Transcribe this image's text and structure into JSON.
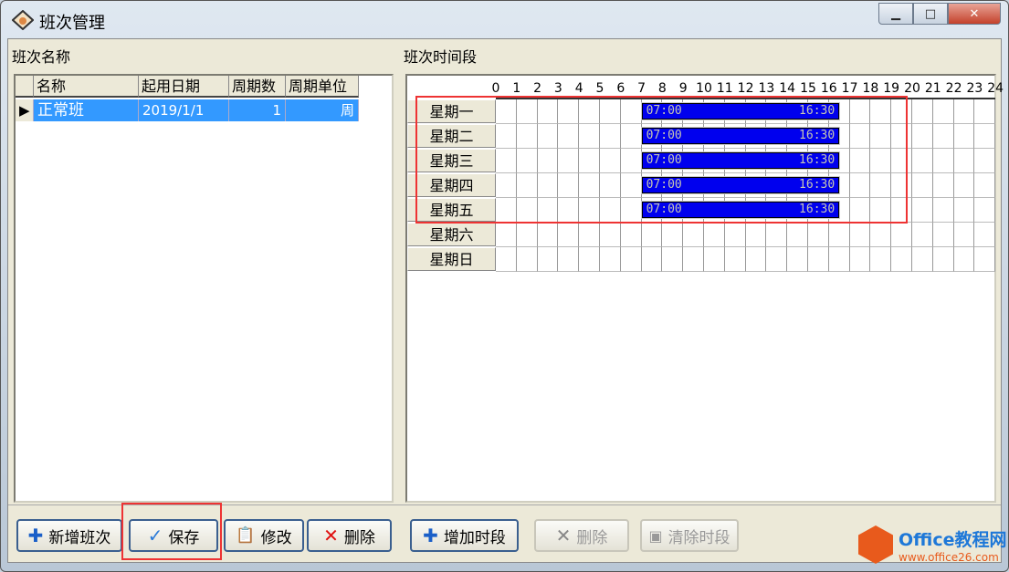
{
  "window": {
    "title": "班次管理",
    "buttons": {
      "minimize": "▁",
      "maximize": "□",
      "close": "✕"
    }
  },
  "left": {
    "header": "班次名称",
    "columns": [
      "名称",
      "起用日期",
      "周期数",
      "周期单位"
    ],
    "rows": [
      {
        "name": "正常班",
        "start": "2019/1/1",
        "count": "1",
        "unit": "周",
        "selected": true
      }
    ]
  },
  "right": {
    "header": "班次时间段",
    "hours": [
      "0",
      "1",
      "2",
      "3",
      "4",
      "5",
      "6",
      "7",
      "8",
      "9",
      "10",
      "11",
      "12",
      "13",
      "14",
      "15",
      "16",
      "17",
      "18",
      "19",
      "20",
      "21",
      "22",
      "23",
      "24"
    ],
    "days": [
      "星期一",
      "星期二",
      "星期三",
      "星期四",
      "星期五",
      "星期六",
      "星期日"
    ],
    "segments": [
      {
        "day": 0,
        "start": "07:00",
        "end": "16:30"
      },
      {
        "day": 1,
        "start": "07:00",
        "end": "16:30"
      },
      {
        "day": 2,
        "start": "07:00",
        "end": "16:30"
      },
      {
        "day": 3,
        "start": "07:00",
        "end": "16:30"
      },
      {
        "day": 4,
        "start": "07:00",
        "end": "16:30"
      }
    ],
    "bar_color": "#0000ee"
  },
  "buttons": {
    "add": "新增班次",
    "save": "保存",
    "edit": "修改",
    "delete": "删除",
    "add_segment": "增加时段",
    "delete_segment": "删除",
    "clear_segment": "清除时段"
  },
  "watermark": {
    "line1": "Office教程网",
    "line2": "www.office26.com"
  }
}
